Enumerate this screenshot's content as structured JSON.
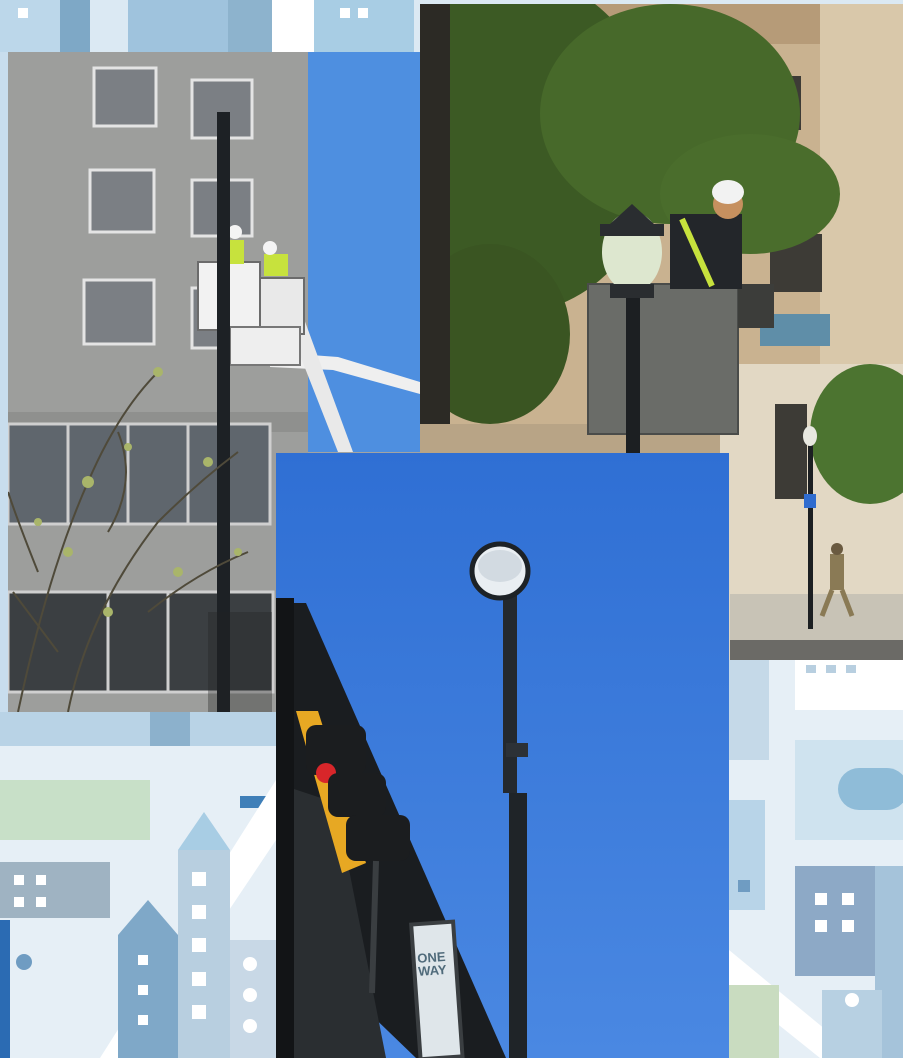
{
  "image": {
    "kind": "photo-collage",
    "palette": {
      "background": "#dbe9f3",
      "sky": "#3f7fd6",
      "building_gray": "#9a9b9a",
      "building_stone": "#c9b290",
      "foliage": "#3c5a24",
      "pole": "#1c1f22",
      "signal_red": "#d8262a",
      "signal_housing": "#e7a823",
      "safety_vest": "#c7e23d"
    },
    "photos": [
      {
        "subject": "bucket-truck-workers-installing-streetlight"
      },
      {
        "subject": "worker-servicing-ornamental-lamp"
      },
      {
        "subject": "led-streetlight-with-traffic-signal"
      }
    ],
    "sign_text": "ONE WAY"
  }
}
